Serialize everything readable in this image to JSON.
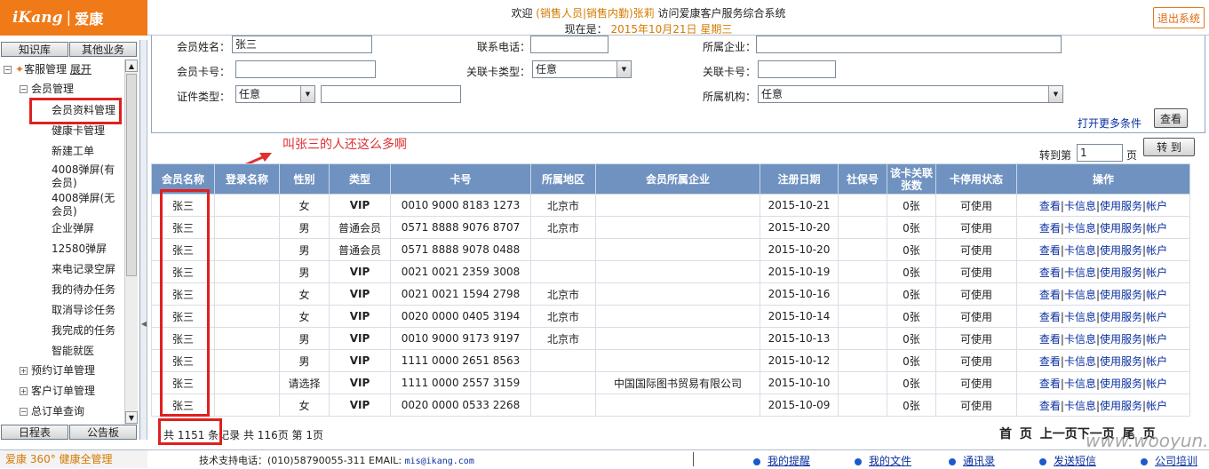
{
  "header": {
    "logo_en": "iKang",
    "logo_sep": "|",
    "logo_cn": "爱康",
    "welcome_prefix": "欢迎",
    "welcome_role": "(销售人员|销售内勤)张莉",
    "welcome_suffix": "访问爱康客户服务综合系统",
    "date_label": "现在是：",
    "date_value": "2015年10月21日 星期三",
    "logout": "退出系统"
  },
  "left": {
    "tab_top_left": "知识库",
    "tab_top_right": "其他业务",
    "tab_bottom_left": "日程表",
    "tab_bottom_right": "公告板",
    "tree": {
      "root": "客服管理",
      "expand": "展开",
      "group": "会员管理",
      "items": [
        "会员资料管理",
        "健康卡管理",
        "新建工单",
        "4008弹屏(有会员)",
        "4008弹屏(无会员)",
        "企业弹屏",
        "12580弹屏",
        "来电记录空屏",
        "我的待办任务",
        "取消导诊任务",
        "我完成的任务",
        "智能就医"
      ],
      "sub1": "预约订单管理",
      "sub2": "客户订单管理",
      "sub3": "总订单查询"
    }
  },
  "search": {
    "name_label": "会员姓名：",
    "name_value": "张三",
    "phone_label": "联系电话：",
    "company_label": "所属企业：",
    "card_label": "会员卡号：",
    "linktype_label": "关联卡类型：",
    "linktype_value": "任意",
    "linkcard_label": "关联卡号：",
    "idtype_label": "证件类型：",
    "idtype_value": "任意",
    "org_label": "所属机构：",
    "org_value": "任意",
    "more": "打开更多条件",
    "query": "查看"
  },
  "annotation": "叫张三的人还这么多啊",
  "goto": {
    "prefix": "转到第",
    "value": "1",
    "suffix": "页",
    "button": "转 到"
  },
  "table": {
    "headers": [
      "会员名称",
      "登录名称",
      "性别",
      "类型",
      "卡号",
      "所属地区",
      "会员所属企业",
      "注册日期",
      "社保号",
      "该卡关联张数",
      "卡停用状态",
      "操作"
    ],
    "rows": [
      [
        "张三",
        "",
        "女",
        "VIP",
        "0010 9000 8183 1273",
        "北京市",
        "",
        "2015-10-21",
        "",
        "0张",
        "可使用"
      ],
      [
        "张三",
        "",
        "男",
        "普通会员",
        "0571 8888 9076 8707",
        "北京市",
        "",
        "2015-10-20",
        "",
        "0张",
        "可使用"
      ],
      [
        "张三",
        "",
        "男",
        "普通会员",
        "0571 8888 9078 0488",
        "",
        "",
        "2015-10-20",
        "",
        "0张",
        "可使用"
      ],
      [
        "张三",
        "",
        "男",
        "VIP",
        "0021 0021 2359 3008",
        "",
        "",
        "2015-10-19",
        "",
        "0张",
        "可使用"
      ],
      [
        "张三",
        "",
        "女",
        "VIP",
        "0021 0021 1594 2798",
        "北京市",
        "",
        "2015-10-16",
        "",
        "0张",
        "可使用"
      ],
      [
        "张三",
        "",
        "女",
        "VIP",
        "0020 0000 0405 3194",
        "北京市",
        "",
        "2015-10-14",
        "",
        "0张",
        "可使用"
      ],
      [
        "张三",
        "",
        "男",
        "VIP",
        "0010 9000 9173 9197",
        "北京市",
        "",
        "2015-10-13",
        "",
        "0张",
        "可使用"
      ],
      [
        "张三",
        "",
        "男",
        "VIP",
        "1111 0000 2651 8563",
        "",
        "",
        "2015-10-12",
        "",
        "0张",
        "可使用"
      ],
      [
        "张三",
        "",
        "请选择",
        "VIP",
        "1111 0000 2557 3159",
        "",
        "中国国际图书贸易有限公司",
        "2015-10-10",
        "",
        "0张",
        "可使用"
      ],
      [
        "张三",
        "",
        "女",
        "VIP",
        "0020 0000 0533 2268",
        "",
        "",
        "2015-10-09",
        "",
        "0张",
        "可使用"
      ]
    ],
    "ops": [
      "查看",
      "卡信息",
      "使用服务",
      "帐户"
    ]
  },
  "pagination": {
    "info": "共 1151 条记录 共 116页 第 1页",
    "first": "首 页",
    "prev": "上一页",
    "next": "下一页",
    "last": "尾 页"
  },
  "footer": {
    "brand": "爱康 360° 健康全管理",
    "tech": "技术支持电话：(010)58790055-311 EMAIL:",
    "email": "mis@ikang.com",
    "links": [
      "我的提醒",
      "我的文件",
      "通讯录",
      "发送短信",
      "公司培训"
    ]
  },
  "watermark": "www.wooyun.org"
}
